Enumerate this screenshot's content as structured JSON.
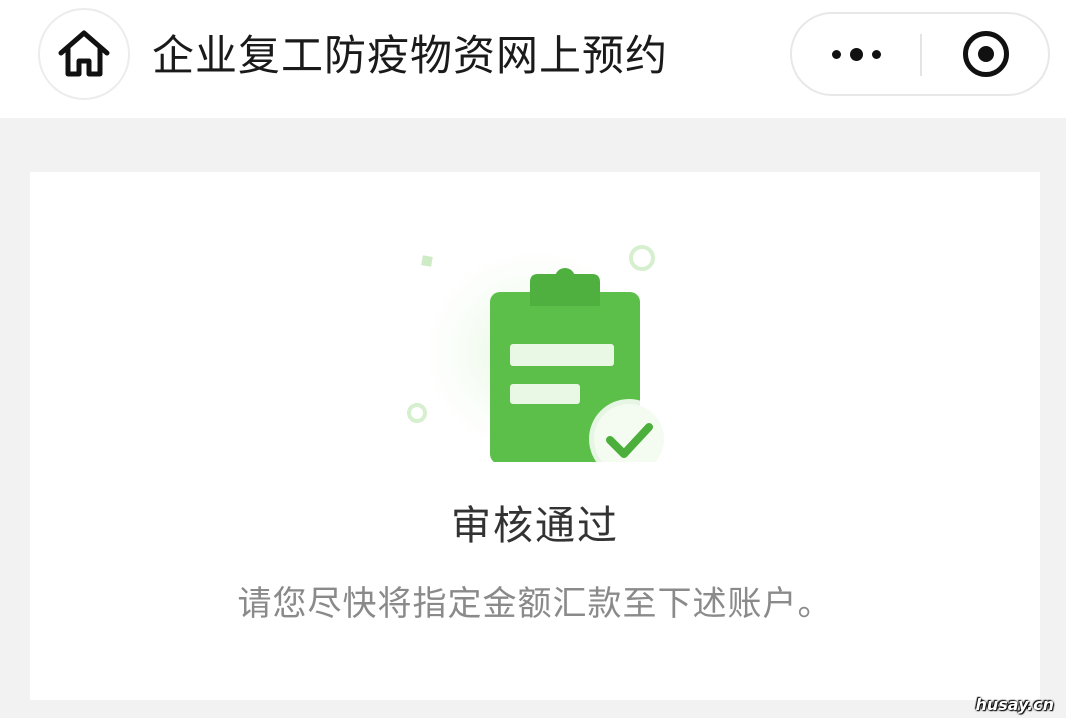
{
  "navbar": {
    "title": "企业复工防疫物资网上预约",
    "home_icon": "home-icon",
    "more_icon": "more-dots-icon",
    "close_icon": "target-close-icon"
  },
  "result": {
    "illustration_icon": "clipboard-check-icon",
    "title": "审核通过",
    "description": "请您尽快将指定金额汇款至下述账户。"
  },
  "watermark": "husay.cn",
  "colors": {
    "accent_green": "#5cbf4a",
    "check_green": "#4caf3c",
    "background": "#f2f2f2"
  }
}
